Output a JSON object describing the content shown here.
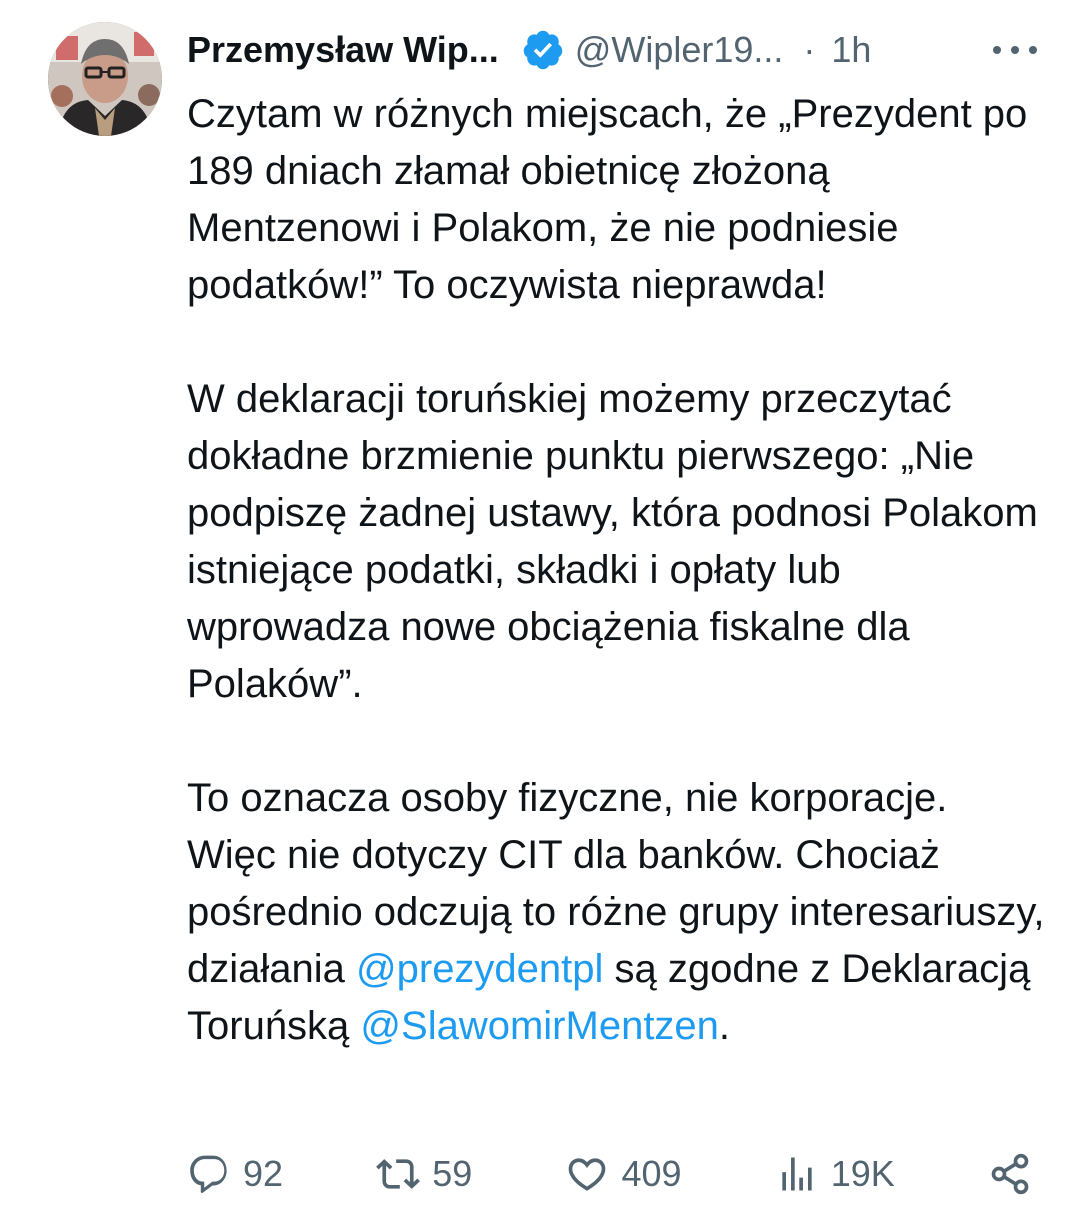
{
  "tweet": {
    "author": {
      "name": "Przemysław Wip...",
      "handle": "@Wipler19...",
      "separator": "·",
      "time": "1h",
      "verified": true,
      "avatar": "avatar-photo"
    },
    "paragraphs": [
      [
        {
          "type": "text",
          "text": "Czytam w różnych miejscach, że „Prezydent po 189 dniach złamał obietnicę złożoną Mentzenowi i Polakom, że nie podniesie podatków!” To oczywista nieprawda!"
        }
      ],
      [
        {
          "type": "text",
          "text": "W deklaracji toruńskiej możemy przeczytać dokładne brzmienie punktu pierwszego: „Nie podpiszę żadnej ustawy, która podnosi Polakom istniejące podatki, składki i opłaty lub wprowadza nowe obciążenia fiskalne dla Polaków”."
        }
      ],
      [
        {
          "type": "text",
          "text": "To oznacza osoby fizyczne, nie korporacje. Więc nie dotyczy CIT dla banków. Chociaż pośrednio odczują to różne grupy interesariuszy, działania "
        },
        {
          "type": "mention",
          "text": "@prezydentpl"
        },
        {
          "type": "text",
          "text": " są zgodne z Deklaracją Toruńską "
        },
        {
          "type": "mention",
          "text": "@SlawomirMentzen"
        },
        {
          "type": "text",
          "text": "."
        }
      ]
    ],
    "actions": [
      {
        "name": "reply",
        "icon": "reply-icon",
        "count": "92"
      },
      {
        "name": "retweet",
        "icon": "retweet-icon",
        "count": "59"
      },
      {
        "name": "like",
        "icon": "heart-icon",
        "count": "409"
      },
      {
        "name": "views",
        "icon": "views-icon",
        "count": "19K"
      },
      {
        "name": "share",
        "icon": "share-icon",
        "count": ""
      }
    ],
    "colors": {
      "text": "#0f1419",
      "secondary": "#536471",
      "link": "#1d9bf0",
      "verified": "#1d9bf0",
      "background": "#ffffff"
    }
  }
}
